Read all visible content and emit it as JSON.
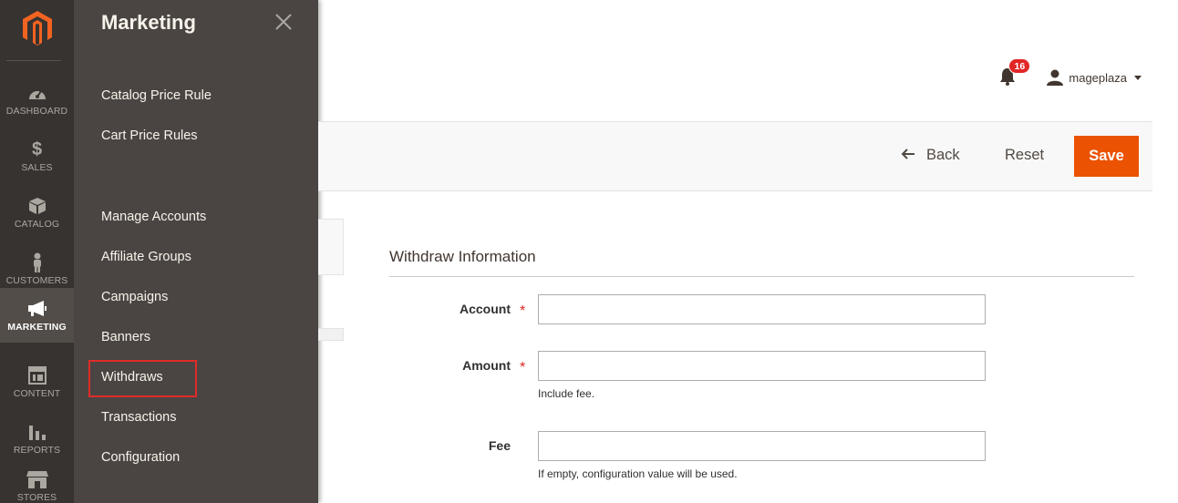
{
  "nav": {
    "items": [
      {
        "label": "DASHBOARD",
        "icon": "dashboard-icon"
      },
      {
        "label": "$",
        "sub": "SALES",
        "icon": "dollar-icon"
      },
      {
        "label": "CATALOG",
        "icon": "cube-icon"
      },
      {
        "label": "CUSTOMERS",
        "icon": "person-icon"
      },
      {
        "label": "MARKETING",
        "icon": "megaphone-icon"
      },
      {
        "label": "CONTENT",
        "icon": "layout-icon"
      },
      {
        "label": "REPORTS",
        "icon": "bar-chart-icon"
      },
      {
        "label": "STORES",
        "icon": "store-icon"
      }
    ],
    "active": "MARKETING"
  },
  "submenu": {
    "title": "Marketing",
    "groups": [
      [
        "Catalog Price Rule",
        "Cart Price Rules"
      ],
      [
        "Manage Accounts",
        "Affiliate Groups",
        "Campaigns",
        "Banners",
        "Withdraws",
        "Transactions",
        "Configuration"
      ]
    ],
    "highlighted": "Withdraws"
  },
  "header": {
    "notifications_count": "16",
    "user_name": "mageplaza"
  },
  "actions": {
    "back_label": "Back",
    "reset_label": "Reset",
    "save_label": "Save"
  },
  "form": {
    "section_title": "Withdraw Information",
    "fields": [
      {
        "label": "Account",
        "required": true,
        "value": "",
        "note": ""
      },
      {
        "label": "Amount",
        "required": true,
        "value": "",
        "note": "Include fee."
      },
      {
        "label": "Fee",
        "required": false,
        "value": "",
        "note": "If empty, configuration value will be used."
      }
    ]
  },
  "colors": {
    "nav_bg": "#373330",
    "submenu_bg": "#4a4542",
    "accent": "#eb5202",
    "highlight_border": "#e02b27",
    "badge": "#e22626"
  }
}
